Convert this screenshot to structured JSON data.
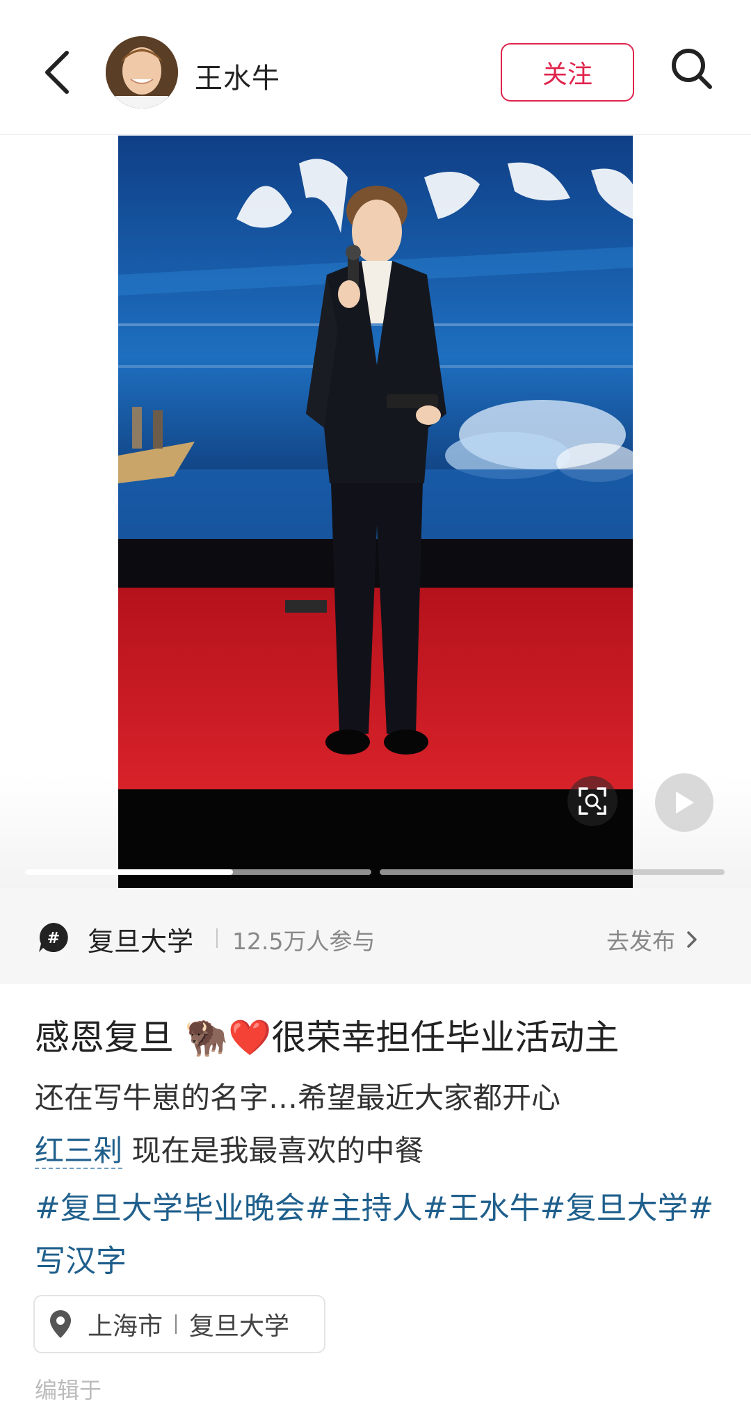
{
  "header": {
    "author_name": "王水牛",
    "follow_label": "关注"
  },
  "media": {
    "gallery_progress": [
      0.6,
      0.0
    ]
  },
  "topic": {
    "name": "复旦大学",
    "participants": "12.5万人参与",
    "publish_label": "去发布"
  },
  "post": {
    "title": "感恩复旦 🦬❤️很荣幸担任毕业活动主",
    "line1": "还在写牛崽的名字…希望最近大家都开心",
    "keyword": "红三剁",
    "line2_rest": " 现在是我最喜欢的中餐",
    "hashtags": "#复旦大学毕业晚会#主持人#王水牛#复旦大学#写汉字"
  },
  "location": {
    "city": "上海市",
    "place": "复旦大学"
  },
  "footer": {
    "hint": "编辑于"
  },
  "colors": {
    "accent": "#e0244c",
    "link": "#1f5f8c"
  }
}
